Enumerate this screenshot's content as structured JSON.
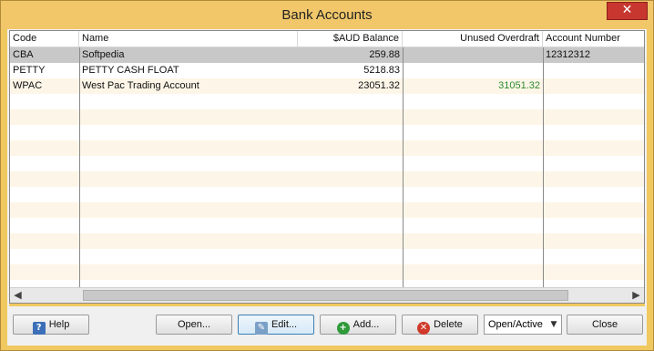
{
  "window": {
    "title": "Bank Accounts",
    "close_glyph": "✕"
  },
  "table": {
    "columns": [
      "Code",
      "Name",
      "$AUD Balance",
      "Unused Overdraft",
      "Account Number"
    ],
    "rows": [
      {
        "code": "CBA",
        "name": "Softpedia",
        "balance": "259.88",
        "overdraft": "",
        "account": "12312312"
      },
      {
        "code": "PETTY",
        "name": "PETTY CASH FLOAT",
        "balance": "5218.83",
        "overdraft": "",
        "account": ""
      },
      {
        "code": "WPAC",
        "name": "West Pac Trading Account",
        "balance": "23051.32",
        "overdraft": "31051.32",
        "account": ""
      }
    ],
    "selected_row": 0,
    "overdraft_color": "#2f8a2f"
  },
  "scrollbar": {
    "left_arrow": "◀",
    "right_arrow": "▶"
  },
  "buttons": {
    "help": "Help",
    "open": "Open...",
    "edit": "Edit...",
    "add": "Add...",
    "delete": "Delete",
    "filter_value": "Open/Active",
    "close": "Close"
  },
  "icons": {
    "help_icon": "?",
    "edit_icon": "✎",
    "add_icon": "+",
    "delete_icon": "✕",
    "dropdown_icon": "▼"
  }
}
